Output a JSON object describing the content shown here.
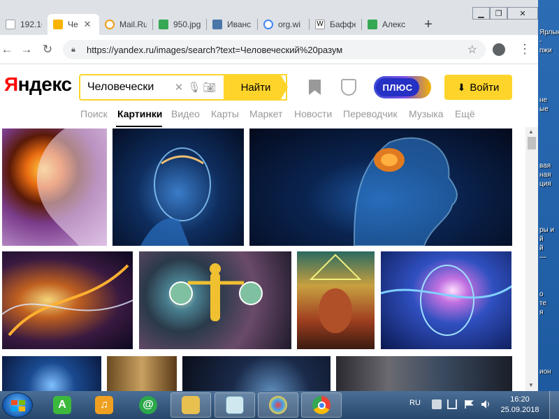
{
  "tabs": [
    {
      "label": "192.16",
      "favicon_color": "#9aa0a6"
    },
    {
      "label": "Че",
      "favicon_color": "#f8b400",
      "active": true
    },
    {
      "label": "Mail.Ru",
      "favicon_color": "#f09c1a"
    },
    {
      "label": "950.jpg",
      "favicon_color": "#34a853"
    },
    {
      "label": "Иванс",
      "favicon_color": "#4a76a8"
    },
    {
      "label": "org.wi",
      "favicon_color": "#4285f4"
    },
    {
      "label": "Баффе",
      "favicon_color": "#000000"
    },
    {
      "label": "Алекс",
      "favicon_color": "#34a853"
    }
  ],
  "toolbar": {
    "url": "https://yandex.ru/images/search?text=Человеческий%20разум"
  },
  "yandex": {
    "logo": "Яндекс",
    "logo_first": "Я",
    "logo_rest": "ндекс",
    "query": "Человечески",
    "search_button": "Найти",
    "plus_label": "ПЛЮС",
    "login_label": "Войти",
    "services": [
      "Поиск",
      "Картинки",
      "Видео",
      "Карты",
      "Маркет",
      "Новости",
      "Переводчик",
      "Музыка",
      "Ещё"
    ],
    "active_service": "Картинки"
  },
  "desktop_texts": [
    "Ярлык\n-\nпжи",
    "не\nые",
    "вая\nная\nция",
    "ры и\nй\nй\n—",
    "о\nте\nя",
    "ион"
  ],
  "taskbar": {
    "language": "RU",
    "time": "16:20",
    "date": "25.09.2018"
  }
}
